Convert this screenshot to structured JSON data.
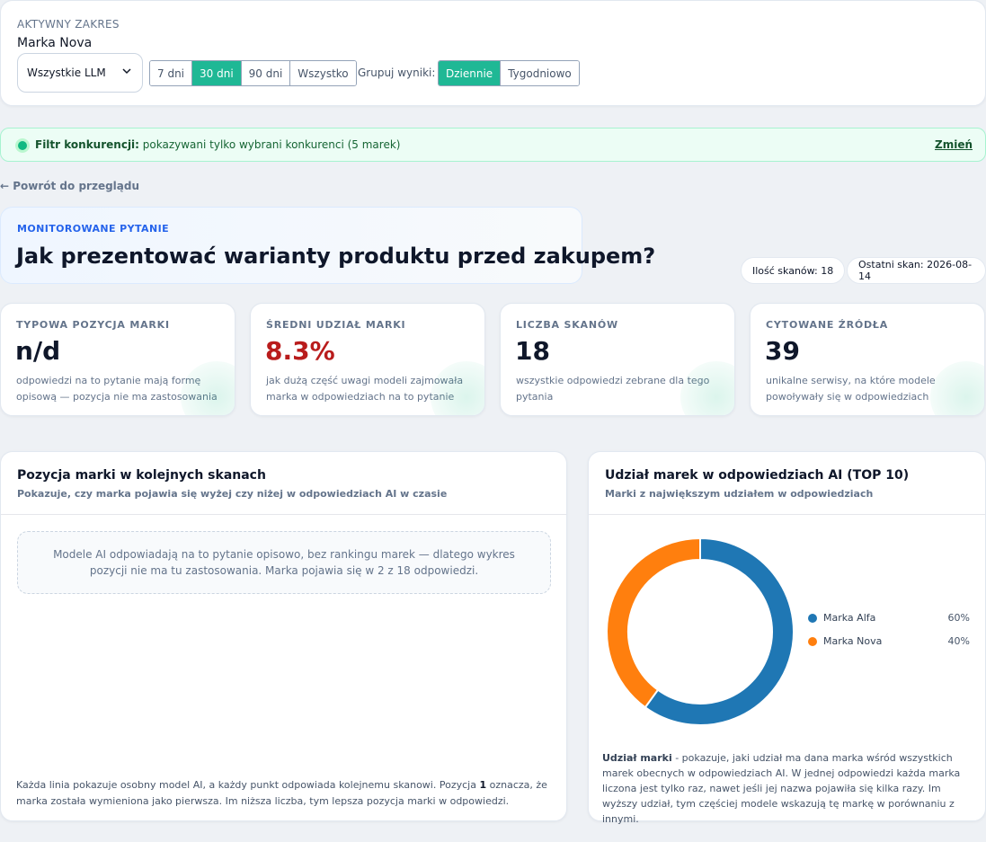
{
  "scope": {
    "label": "AKTYWNY ZAKRES",
    "brand": "Marka Nova",
    "llm_select": "Wszystkie LLM",
    "range_options": [
      "7 dni",
      "30 dni",
      "90 dni",
      "Wszystko"
    ],
    "range_active": "30 dni",
    "group_label": "Grupuj wyniki:",
    "group_options": [
      "Dziennie",
      "Tygodniowo"
    ],
    "group_active": "Dziennie"
  },
  "filter": {
    "title": "Filtr konkurencji:",
    "text": " pokazywani tylko wybrani konkurenci (5 marek)",
    "change": "Zmień"
  },
  "back_link": "← Powrót do przeglądu",
  "question": {
    "label": "MONITOROWANE PYTANIE",
    "text": "Jak prezentować warianty produktu przed zakupem?"
  },
  "pills": {
    "scans": "Ilość skanów: 18",
    "last": "Ostatni skan: 2026-08-14"
  },
  "metrics": [
    {
      "label": "TYPOWA POZYCJA MARKI",
      "value": "n/d",
      "desc": "odpowiedzi na to pytanie mają formę opisową — pozycja nie ma zastosowania"
    },
    {
      "label": "ŚREDNI UDZIAŁ MARKI",
      "value": "8.3%",
      "desc": "jak dużą część uwagi modeli zajmowała marka w odpowiedziach na to pytanie"
    },
    {
      "label": "LICZBA SKANÓW",
      "value": "18",
      "desc": "wszystkie odpowiedzi zebrane dla tego pytania"
    },
    {
      "label": "CYTOWANE ŹRÓDŁA",
      "value": "39",
      "desc": "unikalne serwisy, na które modele powoływały się w odpowiedziach"
    }
  ],
  "position_panel": {
    "title": "Pozycja marki w kolejnych skanach",
    "subtitle": "Pokazuje, czy marka pojawia się wyżej czy niżej w odpowiedziach AI w czasie",
    "empty": "Modele AI odpowiadają na to pytanie opisowo, bez rankingu marek — dlatego wykres pozycji nie ma tu zastosowania. Marka pojawia się w 2 z 18 odpowiedzi.",
    "foot_a": "Każda linia pokazuje osobny model AI, a każdy punkt odpowiada kolejnemu skanowi. Pozycja ",
    "foot_b": "1",
    "foot_c": " oznacza, że marka została wymieniona jako pierwsza. Im niższa liczba, tym lepsza pozycja marki w odpowiedzi."
  },
  "share_panel": {
    "title": "Udział marek w odpowiedziach AI (TOP 10)",
    "subtitle": "Marki z największym udziałem w odpowiedziach",
    "foot_b": "Udział marki",
    "foot_rest": " - pokazuje, jaki udział ma dana marka wśród wszystkich marek obecnych w odpowiedziach AI. W jednej odpowiedzi każda marka liczona jest tylko raz, nawet jeśli jej nazwa pojawiła się kilka razy. Im wyższy udział, tym częściej modele wskazują tę markę w porównaniu z innymi."
  },
  "chart_data": {
    "type": "pie",
    "categories": [
      "Marka Alfa",
      "Marka Nova"
    ],
    "values": [
      60,
      40
    ],
    "labels": [
      "60%",
      "40%"
    ],
    "colors": [
      "#1f77b4",
      "#ff7f0e"
    ],
    "legend": "right"
  }
}
